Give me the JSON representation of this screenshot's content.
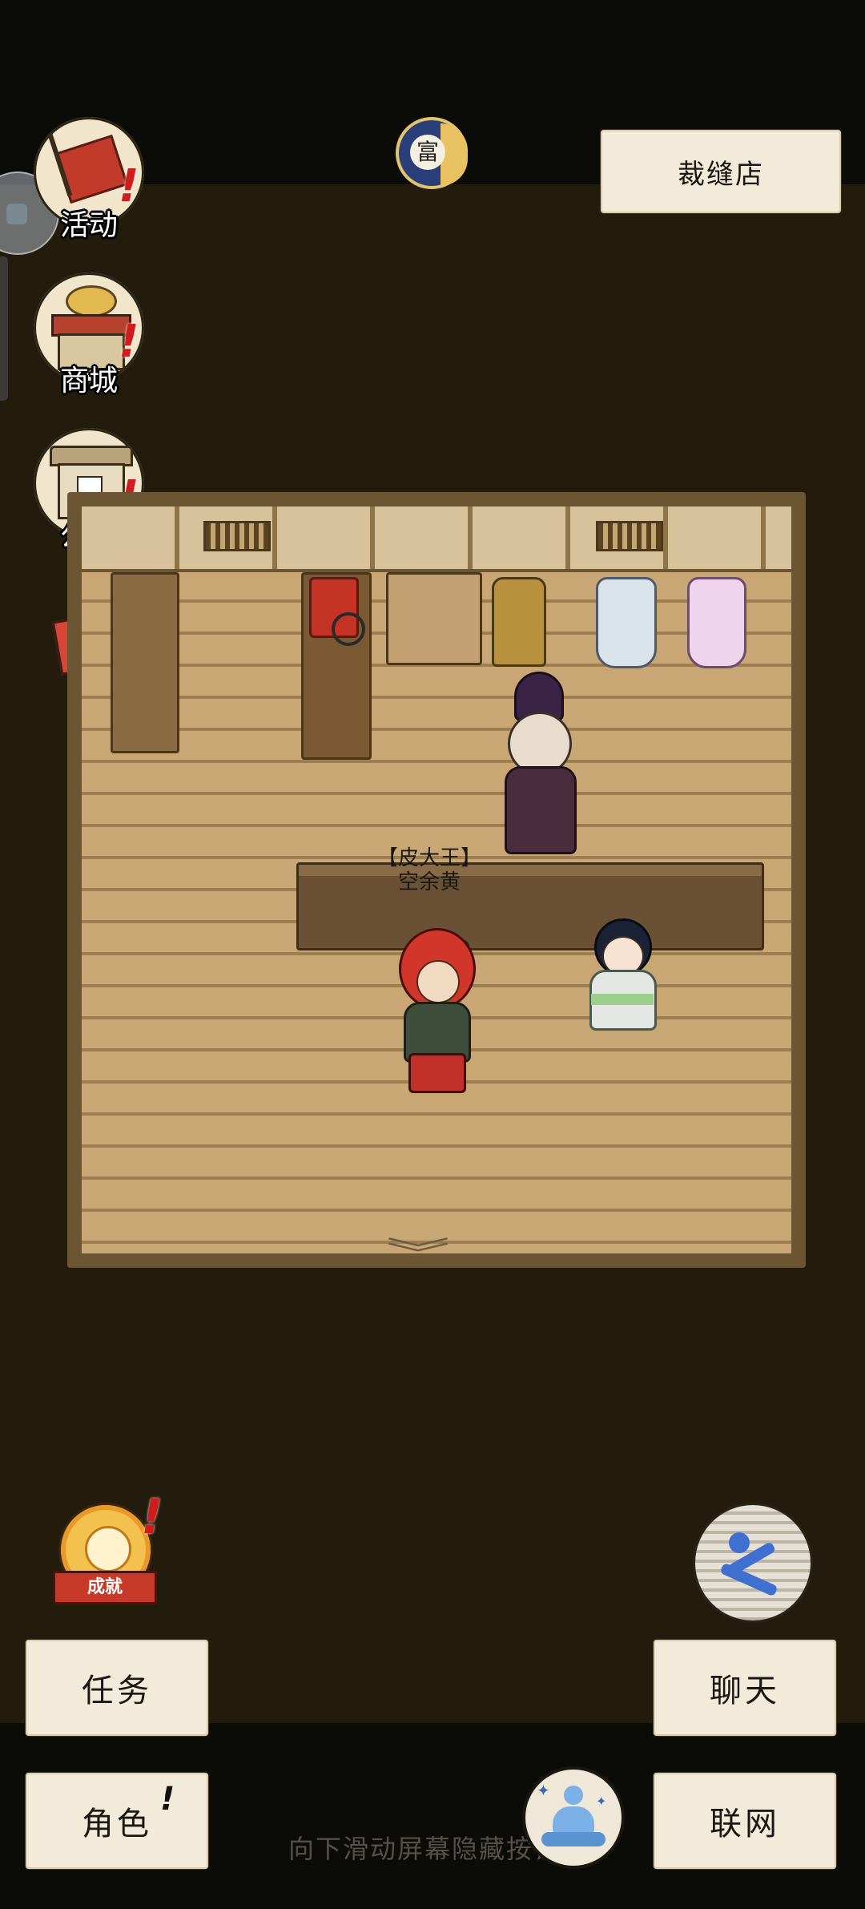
{
  "location": {
    "name": "裁缝店"
  },
  "menu": {
    "activities": {
      "label": "活动",
      "icon": "banner-flag-icon",
      "has_alert": true
    },
    "shop": {
      "label": "商城",
      "icon": "shop-stall-icon",
      "has_alert": true
    },
    "notice": {
      "label": "公告",
      "icon": "notice-board-icon",
      "has_alert": true
    },
    "gift": {
      "icon": "gift-box-icon"
    }
  },
  "top_icon": {
    "icon": "wealth-moon-icon",
    "glyph": "富"
  },
  "scene": {
    "player": {
      "title": "【皮大王】",
      "name": "空余黄"
    },
    "npcs": [
      "tailor-npc",
      "girl-npc"
    ]
  },
  "achievement": {
    "label": "成就",
    "has_alert": true
  },
  "sprint": {
    "icon": "running-man-icon"
  },
  "buttons": {
    "tasks": "任务",
    "character": "角色",
    "character_alert": "!",
    "chat": "聊天",
    "network": "联网"
  },
  "meditate": {
    "icon": "meditation-icon"
  },
  "hint": "向下滑动屏幕隐藏按钮",
  "colors": {
    "background": "#231c0c",
    "paper": "#f2ebd9",
    "alert": "#d21c1c"
  }
}
